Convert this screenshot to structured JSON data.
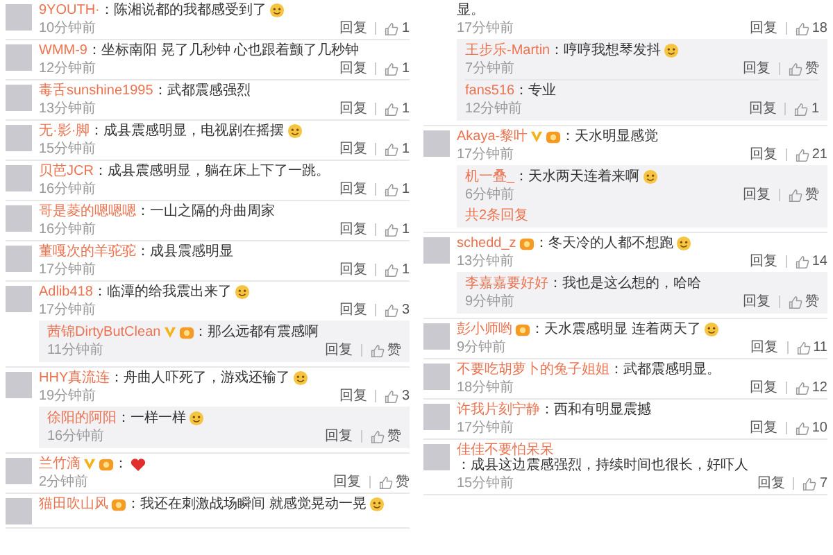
{
  "left_column": {
    "comments": [
      {
        "user": "9YOUTH·",
        "verified": false,
        "vip": false,
        "text": "：陈湘说都的我都感受到了",
        "emoji": true,
        "time": "10分钟前",
        "reply_label": "回复",
        "likes": "1"
      },
      {
        "user": "WMM-9",
        "verified": false,
        "vip": false,
        "text": "：坐标南阳 晃了几秒钟 心也跟着颤了几秒钟",
        "emoji": false,
        "time": "12分钟前",
        "reply_label": "回复",
        "likes": "1"
      },
      {
        "user": "毒舌sunshine1995",
        "verified": false,
        "vip": false,
        "text": "：武都震感强烈",
        "emoji": false,
        "time": "13分钟前",
        "reply_label": "回复",
        "likes": "1"
      },
      {
        "user": "无·影·脚",
        "verified": false,
        "vip": false,
        "text": "：成县震感明显，电视剧在摇摆",
        "emoji": true,
        "time": "15分钟前",
        "reply_label": "回复",
        "likes": "1"
      },
      {
        "user": "贝芭JCR",
        "verified": false,
        "vip": false,
        "text": "：成县震感明显，躺在床上下了一跳。",
        "emoji": false,
        "time": "16分钟前",
        "reply_label": "回复",
        "likes": "1"
      },
      {
        "user": "哥是菱的嗯嗯嗯",
        "verified": false,
        "vip": false,
        "text": "：一山之隔的舟曲周家",
        "emoji": false,
        "time": "16分钟前",
        "reply_label": "回复",
        "likes": "1"
      },
      {
        "user": "董嘎次的羊驼驼",
        "verified": false,
        "vip": false,
        "text": "：成县震感明显",
        "emoji": false,
        "time": "17分钟前",
        "reply_label": "回复",
        "likes": "1"
      },
      {
        "user": "Adlib418",
        "verified": false,
        "vip": false,
        "text": "：临潭的给我震出来了",
        "emoji": true,
        "time": "17分钟前",
        "reply_label": "回复",
        "likes": "3",
        "replies": [
          {
            "user": "茜锦DirtyButClean",
            "verified": true,
            "vip": true,
            "text": "：那么远都有震感啊",
            "emoji": false,
            "time": "11分钟前",
            "reply_label": "回复",
            "likes": "赞"
          }
        ]
      },
      {
        "user": "HHY真流连",
        "verified": false,
        "vip": false,
        "text": "：舟曲人吓死了，游戏还输了",
        "emoji": true,
        "time": "19分钟前",
        "reply_label": "回复",
        "likes": "3",
        "replies": [
          {
            "user": "徐阳的阿阳",
            "verified": false,
            "vip": false,
            "text": "：一样一样",
            "emoji": true,
            "time": "16分钟前",
            "reply_label": "回复",
            "likes": "赞"
          }
        ]
      },
      {
        "user": "兰竹滴",
        "verified": true,
        "vip": true,
        "text": "：",
        "emoji": false,
        "heart": true,
        "time": "2分钟前",
        "reply_label": "回复",
        "likes": "赞"
      },
      {
        "user": "猫田吹山风",
        "verified": false,
        "vip": true,
        "text": "：我还在刺激战场瞬间 就感觉晃动一晃",
        "emoji": true
      }
    ]
  },
  "right_column": {
    "continued": {
      "text": "显。",
      "time": "17分钟前",
      "reply_label": "回复",
      "likes": "18",
      "replies": [
        {
          "user": "王步乐-Martin",
          "verified": false,
          "vip": false,
          "text": "：哼哼我想琴发抖",
          "emoji": true,
          "time": "7分钟前",
          "reply_label": "回复",
          "likes": "赞"
        },
        {
          "user": "fans516",
          "verified": false,
          "vip": false,
          "text": "：专业",
          "emoji": false,
          "time": "12分钟前",
          "reply_label": "回复",
          "likes": "1"
        }
      ]
    },
    "comments": [
      {
        "user": "Akaya-黎叶",
        "verified": true,
        "vip": true,
        "text": "：天水明显感觉",
        "emoji": false,
        "time": "17分钟前",
        "reply_label": "回复",
        "likes": "21",
        "replies": [
          {
            "user": "机一叠_",
            "verified": false,
            "vip": false,
            "text": "：天水两天连着来啊",
            "emoji": true,
            "time": "6分钟前",
            "reply_label": "回复",
            "likes": "赞"
          }
        ],
        "more_replies": "共2条回复"
      },
      {
        "user": "schedd_z",
        "verified": false,
        "vip": true,
        "text": "：冬天冷的人都不想跑",
        "emoji": true,
        "time": "13分钟前",
        "reply_label": "回复",
        "likes": "14",
        "replies": [
          {
            "user": "李嘉嘉要好好",
            "verified": false,
            "vip": false,
            "text": "：我也是这么想的，哈哈",
            "emoji": false,
            "time": "9分钟前",
            "reply_label": "回复",
            "likes": "赞"
          }
        ]
      },
      {
        "user": "彭小师哟",
        "verified": false,
        "vip": true,
        "text": "：天水震感明显 连着两天了",
        "emoji": true,
        "time": "9分钟前",
        "reply_label": "回复",
        "likes": "11"
      },
      {
        "user": "不要吃胡萝卜的兔子姐姐",
        "verified": false,
        "vip": false,
        "text": "：武都震感明显。",
        "emoji": false,
        "time": "18分钟前",
        "reply_label": "回复",
        "likes": "12"
      },
      {
        "user": "许我片刻宁静",
        "verified": false,
        "vip": false,
        "text": "：西和有明显震撼",
        "emoji": false,
        "time": "17分钟前",
        "reply_label": "回复",
        "likes": "10"
      },
      {
        "user": "佳佳不要怕呆呆",
        "verified": false,
        "vip": false,
        "text": "：成县这边震感强烈，持续时间也很长，好吓人",
        "emoji": false,
        "time": "15分钟前",
        "reply_label": "回复",
        "likes": "7"
      }
    ]
  }
}
